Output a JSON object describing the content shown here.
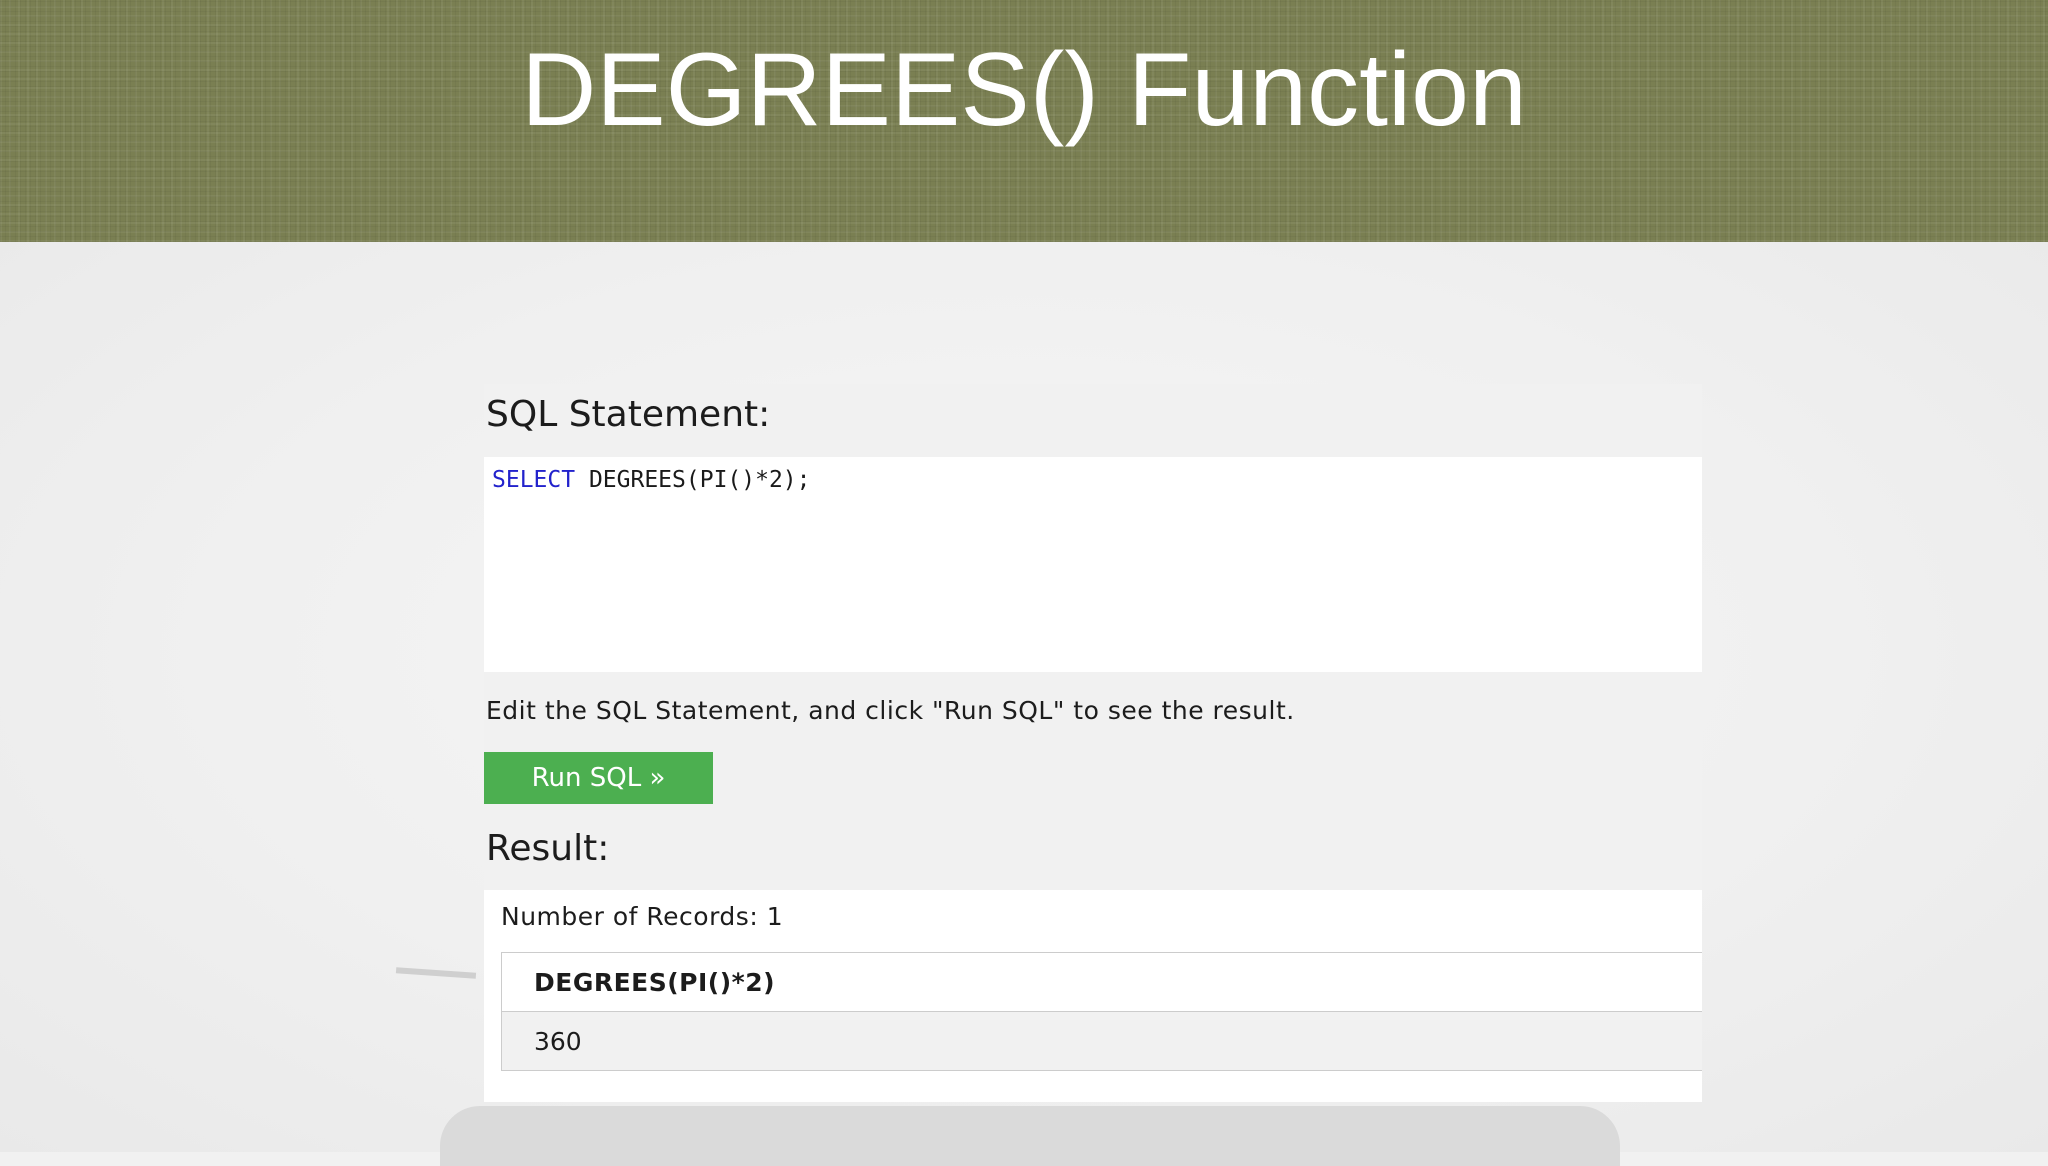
{
  "banner": {
    "title": "DEGREES() Function"
  },
  "editor_panel": {
    "sql_heading": "SQL Statement:",
    "code_keyword": "SELECT",
    "code_rest": " DEGREES(PI()*2);",
    "hint": "Edit the SQL Statement, and click \"Run SQL\" to see the result.",
    "run_button_label": "Run SQL »"
  },
  "result": {
    "heading": "Result:",
    "records_label": "Number of Records: 1",
    "columns": [
      "DEGREES(PI()*2)"
    ],
    "rows": [
      [
        "360"
      ]
    ]
  },
  "colors": {
    "banner": "#7a7f52",
    "run_button": "#4caf50",
    "keyword": "#2222cc"
  }
}
